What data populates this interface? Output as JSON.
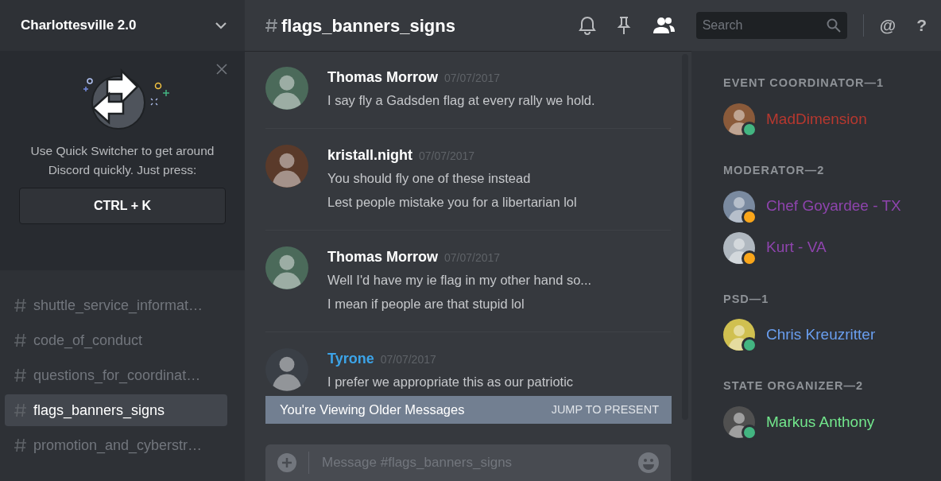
{
  "server": {
    "name": "Charlottesville 2.0"
  },
  "quick_switcher": {
    "message": "Use Quick Switcher to get around Discord quickly. Just press:",
    "shortcut": "CTRL + K"
  },
  "channels": [
    {
      "name": "shuttle_service_informat…",
      "selected": false
    },
    {
      "name": "code_of_conduct",
      "selected": false
    },
    {
      "name": "questions_for_coordinat…",
      "selected": false
    },
    {
      "name": "flags_banners_signs",
      "selected": true
    },
    {
      "name": "promotion_and_cyberstr…",
      "selected": false
    }
  ],
  "channel_header": {
    "name": "flags_banners_signs"
  },
  "search": {
    "placeholder": "Search"
  },
  "header_glyphs": [
    "@",
    "?"
  ],
  "messages": [
    {
      "author": "Thomas Morrow",
      "color": "#ffffff",
      "time": "07/07/2017",
      "lines": [
        "I say fly a Gadsden flag at every rally we hold."
      ]
    },
    {
      "author": "kristall.night",
      "color": "#ffffff",
      "time": "07/07/2017",
      "lines": [
        "You should fly one of these instead",
        "Lest people mistake you for a libertarian lol"
      ]
    },
    {
      "author": "Thomas Morrow",
      "color": "#ffffff",
      "time": "07/07/2017",
      "lines": [
        "Well I'd have my ie flag in my other hand so...",
        "I mean if people are that stupid lol"
      ]
    },
    {
      "author": "Tyrone",
      "color": "#3ca4e8",
      "time": "07/07/2017",
      "lines": [
        "I prefer we appropriate this as our patriotic"
      ]
    }
  ],
  "older_banner": {
    "text": "You're Viewing Older Messages",
    "action": "JUMP TO PRESENT"
  },
  "composer": {
    "placeholder": "Message #flags_banners_signs"
  },
  "member_groups": [
    {
      "title": "EVENT COORDINATOR—1",
      "color": "#b7382f",
      "members": [
        {
          "name": "MadDimension",
          "color": "#43b581"
        }
      ]
    },
    {
      "title": "MODERATOR—2",
      "color": "#8e44ad",
      "members": [
        {
          "name": "Chef Goyardee - TX",
          "color": "#faa61a"
        },
        {
          "name": "Kurt - VA",
          "color": "#faa61a"
        }
      ]
    },
    {
      "title": "PSD—1",
      "color": "#6a9ff0",
      "members": [
        {
          "name": "Chris Kreuzritter",
          "color": "#43b581"
        }
      ]
    },
    {
      "title": "STATE ORGANIZER—2",
      "color": "#72e68c",
      "members": [
        {
          "name": "Markus Anthony",
          "color": "#43b581"
        }
      ]
    }
  ]
}
